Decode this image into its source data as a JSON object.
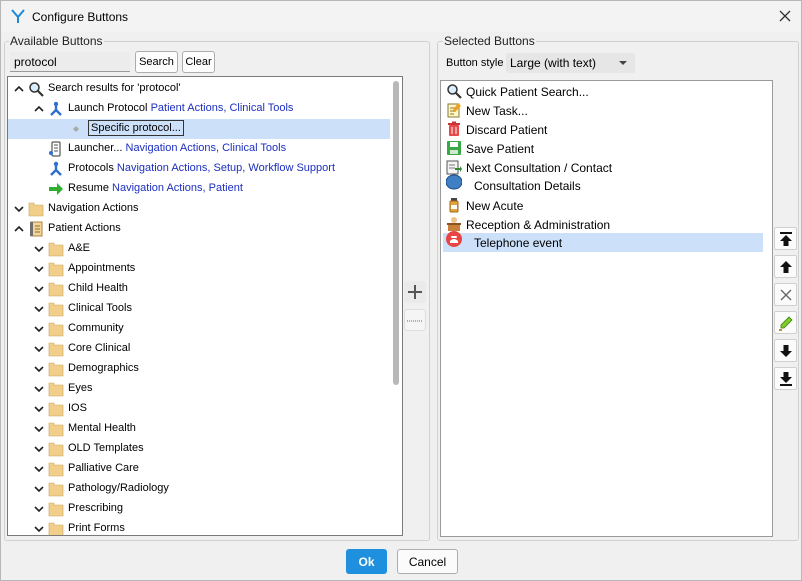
{
  "window": {
    "title": "Configure Buttons"
  },
  "available": {
    "group_label": "Available Buttons",
    "search_value": "protocol",
    "search_button": "Search",
    "clear_button": "Clear",
    "tree": [
      {
        "label": "Search results for 'protocol'",
        "tags": "",
        "icon": "magnifier-icon",
        "expanded": true
      },
      {
        "label": "Launch Protocol",
        "tags": "Patient Actions, Clinical Tools",
        "icon": "protocol-icon",
        "expanded": true
      },
      {
        "label": "Specific protocol...",
        "tags": "",
        "icon": "diamond-icon",
        "selected": true
      },
      {
        "label": "Launcher...",
        "tags": "Navigation Actions, Clinical Tools",
        "icon": "launcher-icon"
      },
      {
        "label": "Protocols",
        "tags": "Navigation Actions, Setup, Workflow Support",
        "icon": "protocol-icon"
      },
      {
        "label": "Resume",
        "tags": "Navigation Actions, Patient",
        "icon": "green-arrow-icon"
      },
      {
        "label": "Navigation Actions",
        "tags": "",
        "icon": "folder-icon",
        "expanded": false
      },
      {
        "label": "Patient Actions",
        "tags": "",
        "icon": "book-icon",
        "expanded": true
      },
      {
        "label": "A&E",
        "icon": "folder-icon"
      },
      {
        "label": "Appointments",
        "icon": "folder-icon"
      },
      {
        "label": "Child Health",
        "icon": "folder-icon"
      },
      {
        "label": "Clinical Tools",
        "icon": "folder-icon"
      },
      {
        "label": "Community",
        "icon": "folder-icon"
      },
      {
        "label": "Core Clinical",
        "icon": "folder-icon"
      },
      {
        "label": "Demographics",
        "icon": "folder-icon"
      },
      {
        "label": "Eyes",
        "icon": "folder-icon"
      },
      {
        "label": "IOS",
        "icon": "folder-icon"
      },
      {
        "label": "Mental Health",
        "icon": "folder-icon"
      },
      {
        "label": "OLD Templates",
        "icon": "folder-icon"
      },
      {
        "label": "Palliative Care",
        "icon": "folder-icon"
      },
      {
        "label": "Pathology/Radiology",
        "icon": "folder-icon"
      },
      {
        "label": "Prescribing",
        "icon": "folder-icon"
      },
      {
        "label": "Print Forms",
        "icon": "folder-icon"
      }
    ]
  },
  "selected": {
    "group_label": "Selected Buttons",
    "style_label": "Button style",
    "style_value": "Large (with text)",
    "items": [
      {
        "label": "Quick Patient Search...",
        "icon": "magnifier-icon"
      },
      {
        "label": "New Task...",
        "icon": "task-icon"
      },
      {
        "label": "Discard Patient",
        "icon": "trash-icon"
      },
      {
        "label": "Save Patient",
        "icon": "save-icon"
      },
      {
        "label": "Next Consultation / Contact",
        "icon": "next-consultation-icon"
      },
      {
        "label": "Consultation Details",
        "icon": "consultation-icon"
      },
      {
        "label": "New Acute",
        "icon": "medicine-bottle-icon"
      },
      {
        "label": "Reception & Administration",
        "icon": "reception-icon"
      },
      {
        "label": "Telephone event",
        "icon": "telephone-icon",
        "selected": true
      }
    ]
  },
  "footer": {
    "ok": "Ok",
    "cancel": "Cancel"
  },
  "colors": {
    "accent": "#1e90dd",
    "selection": "#cce0fa",
    "tag_text": "#1c2fbf"
  }
}
